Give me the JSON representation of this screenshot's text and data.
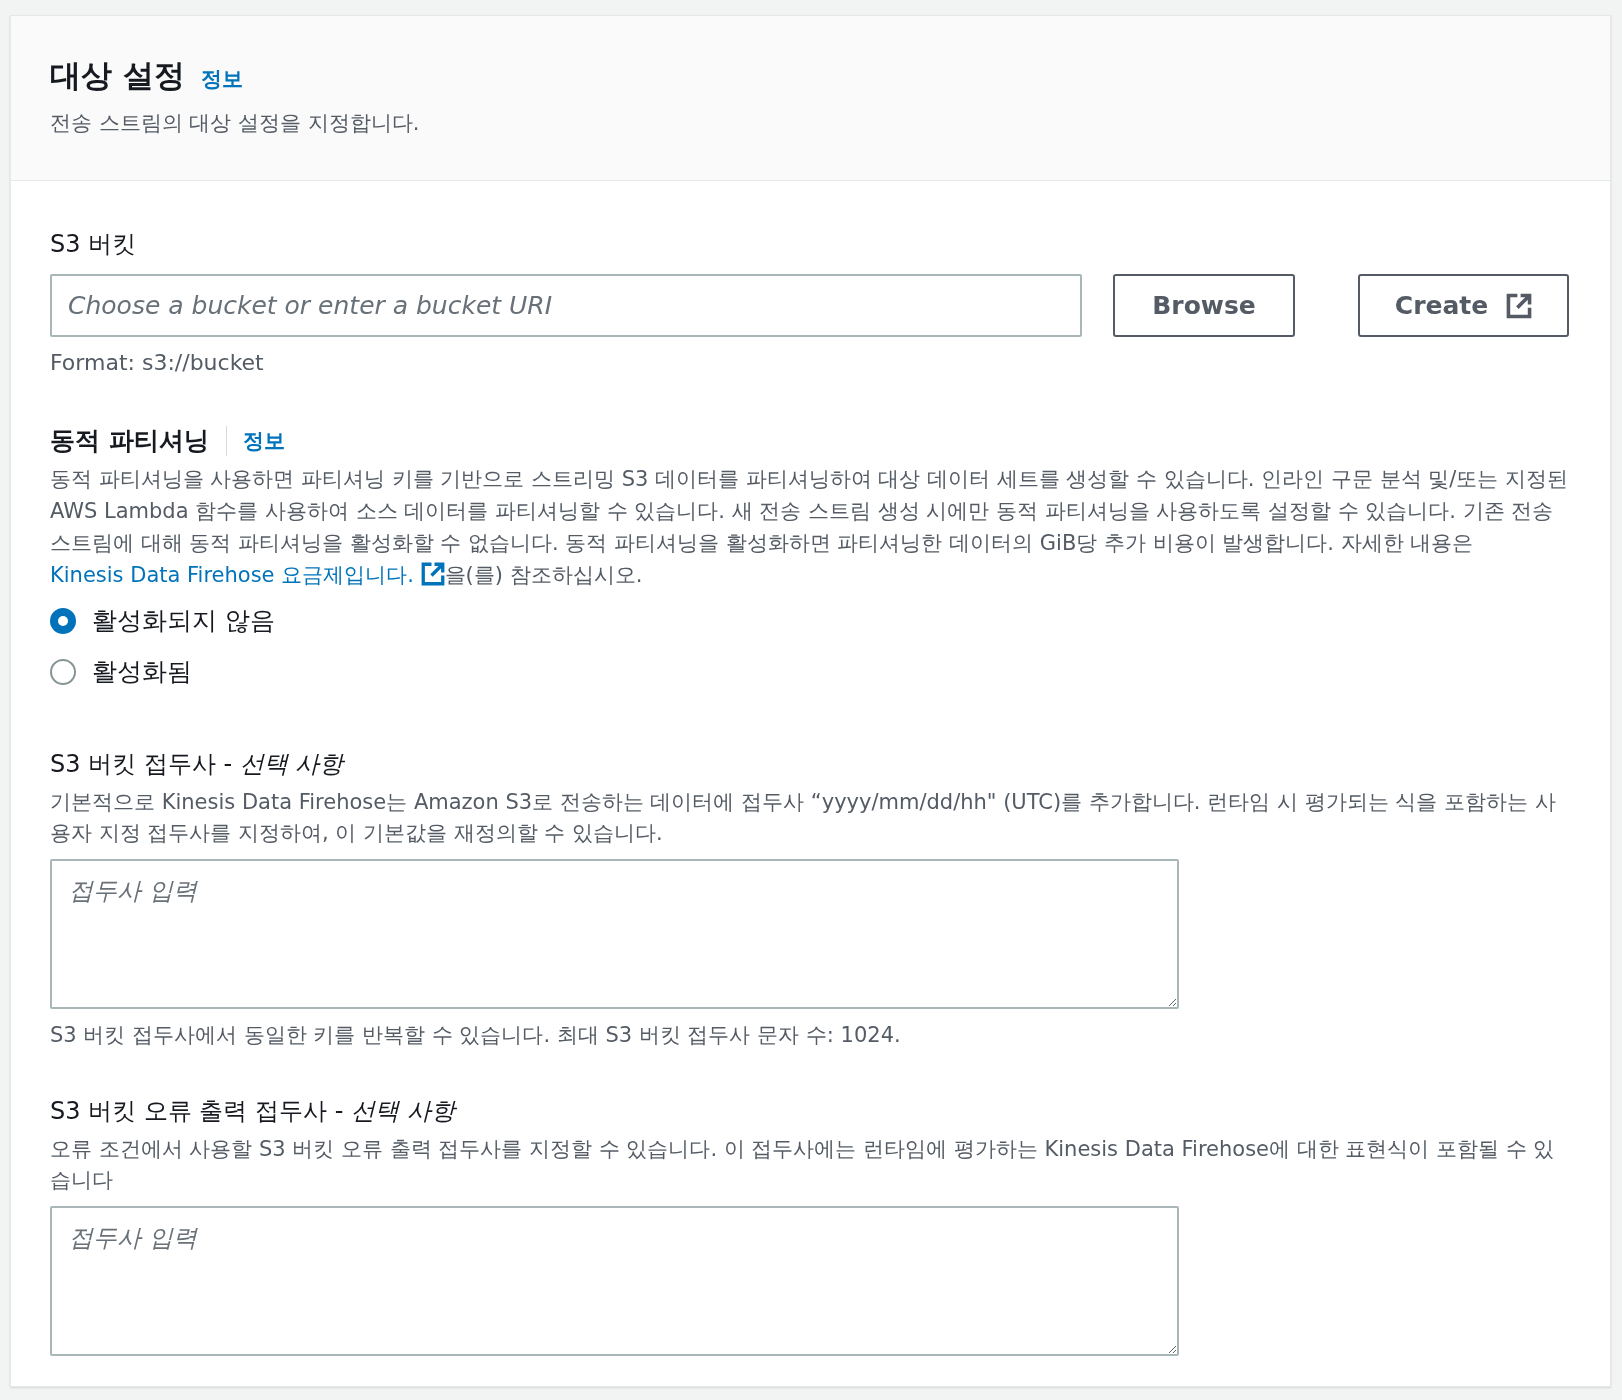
{
  "header": {
    "title": "대상 설정",
    "info_link": "정보",
    "description": "전송 스트림의 대상 설정을 지정합니다."
  },
  "s3_bucket": {
    "label": "S3 버킷",
    "input": {
      "placeholder": "Choose a bucket or enter a bucket URI"
    },
    "buttons": [
      {
        "label": "Browse",
        "external": false
      },
      {
        "label": "Create",
        "external": true
      }
    ],
    "hint": "Format: s3://bucket"
  },
  "dynamic_partitioning": {
    "title": "동적 파티셔닝",
    "info_link": "정보",
    "description": "동적 파티셔닝을 사용하면 파티셔닝 키를 기반으로 스트리밍 S3 데이터를 파티셔닝하여 대상 데이터 세트를 생성할 수 있습니다. 인라인 구문 분석 및/또는 지정된 AWS Lambda 함수를 사용하여 소스 데이터를 파티셔닝할 수 있습니다. 새 전송 스트림 생성 시에만 동적 파티셔닝을 사용하도록 설정할 수 있습니다. 기존 전송 스트림에 대해 동적 파티셔닝을 활성화할 수 없습니다. 동적 파티셔닝을 활성화하면 파티셔닝한 데이터의 GiB당 추가 비용이 발생합니다. 자세한 내용은",
    "link": {
      "text": "Kinesis Data Firehose 요금제입니다.",
      "external": true
    },
    "description_suffix": "을(를) 참조하십시오.",
    "options": [
      {
        "label": "활성화되지 않음",
        "selected": true
      },
      {
        "label": "활성화됨",
        "selected": false
      }
    ]
  },
  "prefix": {
    "label": "S3 버킷 접두사 - *선택 사항*",
    "description": "기본적으로 Kinesis Data Firehose는 Amazon S3로 전송하는 데이터에 접두사 “yyyy/mm/dd/hh\" (UTC)를 추가합니다. 런타임 시 평가되는 식을 포함하는 사용자 지정 접두사를 지정하여, 이 기본값을 재정의할 수 있습니다.",
    "textarea": {
      "placeholder": "접두사 입력"
    },
    "hint": "S3 버킷 접두사에서 동일한 키를 반복할 수 있습니다. 최대 S3 버킷 접두사 문자 수: 1024."
  },
  "error_prefix": {
    "label": "S3 버킷 오류 출력 접두사 - *선택 사항*",
    "description": "오류 조건에서 사용할 S3 버킷 오류 출력 접두사를 지정할 수 있습니다. 이 접두사에는 런타임에 평가하는 Kinesis Data Firehose에 대한 표현식이 포함될 수 있습니다",
    "textarea": {
      "placeholder": "접두사 입력"
    }
  }
}
